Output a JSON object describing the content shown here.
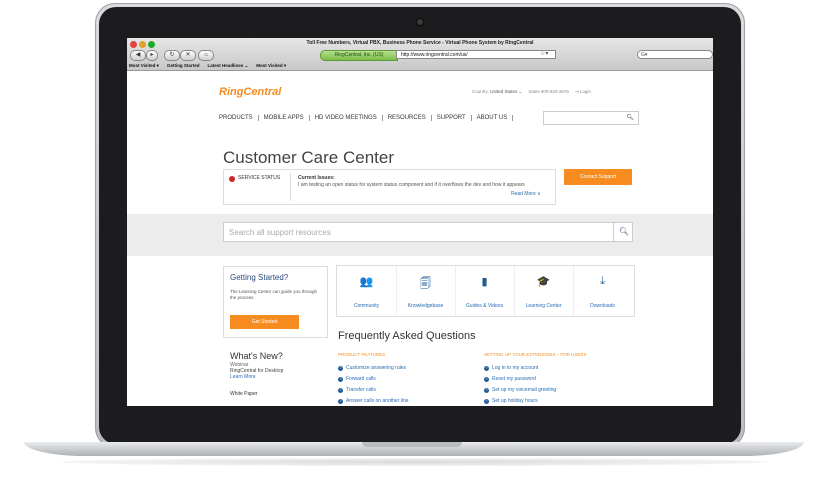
{
  "browser": {
    "window_title": "Toll Free Numbers, Virtual PBX, Business Phone Service - Virtual Phone System by RingCentral",
    "site_identity": "RingCentral, Inc. (US)",
    "url": "http://www.ringcentral.com/us/",
    "bookmarks": [
      "Most Visited ▾",
      "Getting Started",
      "Latest Headlines ⌄",
      "Most Visited ▾"
    ]
  },
  "site": {
    "logo": "RingCentral",
    "utility": {
      "country_label": "Country:",
      "country_value": "United States ⌄",
      "sales": "Sales 800-820-3676",
      "login": "Login"
    },
    "nav": [
      "PRODUCTS",
      "MOBILE APPS",
      "HD VIDEO MEETINGS",
      "RESOURCES",
      "SUPPORT",
      "ABOUT US"
    ],
    "page_title": "Customer Care Center",
    "status": {
      "label": "SERVICE STATUS",
      "issues_title": "Current Issues:",
      "issues_text": "I am testing an open status for system status component and if it overflows the dev and how it appears",
      "read_more": "Read More ∨"
    },
    "contact_button": "Contact Support",
    "support_search_placeholder": "Search all support resources",
    "getting_started": {
      "title": "Getting Started?",
      "description": "The Learning Center can guide you through the process.",
      "button": "Get Started"
    },
    "resources": [
      {
        "label": "Community",
        "icon": "community-icon",
        "glyph": "👥"
      },
      {
        "label": "Knowledgebase",
        "icon": "knowledgebase-icon",
        "glyph": "🗐"
      },
      {
        "label": "Guides & Videos",
        "icon": "guides-icon",
        "glyph": "▮"
      },
      {
        "label": "Learning Center",
        "icon": "graduation-cap-icon",
        "glyph": "🎓"
      },
      {
        "label": "Downloads",
        "icon": "download-icon",
        "glyph": "⤓"
      }
    ],
    "whats_new": {
      "title": "What's New?",
      "type": "Webinar",
      "item": "RingCentral for Desktop",
      "link": "Learn More",
      "white_paper": "White Paper"
    },
    "faq": {
      "title": "Frequently Asked Questions",
      "col1_heading": "PRODUCT FEATURES",
      "col1": [
        "Customize answering rules",
        "Forward calls",
        "Transfer calls",
        "Answer calls on another line"
      ],
      "col2_heading": "SETTING UP YOUR EXTENSIONS – FOR USERS",
      "col2": [
        "Log in to my account",
        "Reset my password",
        "Set up my voicemail greeting",
        "Set up holiday hours"
      ]
    },
    "colors": {
      "accent": "#f68b1f",
      "link": "#2a6db5",
      "status_red": "#d32222"
    }
  }
}
